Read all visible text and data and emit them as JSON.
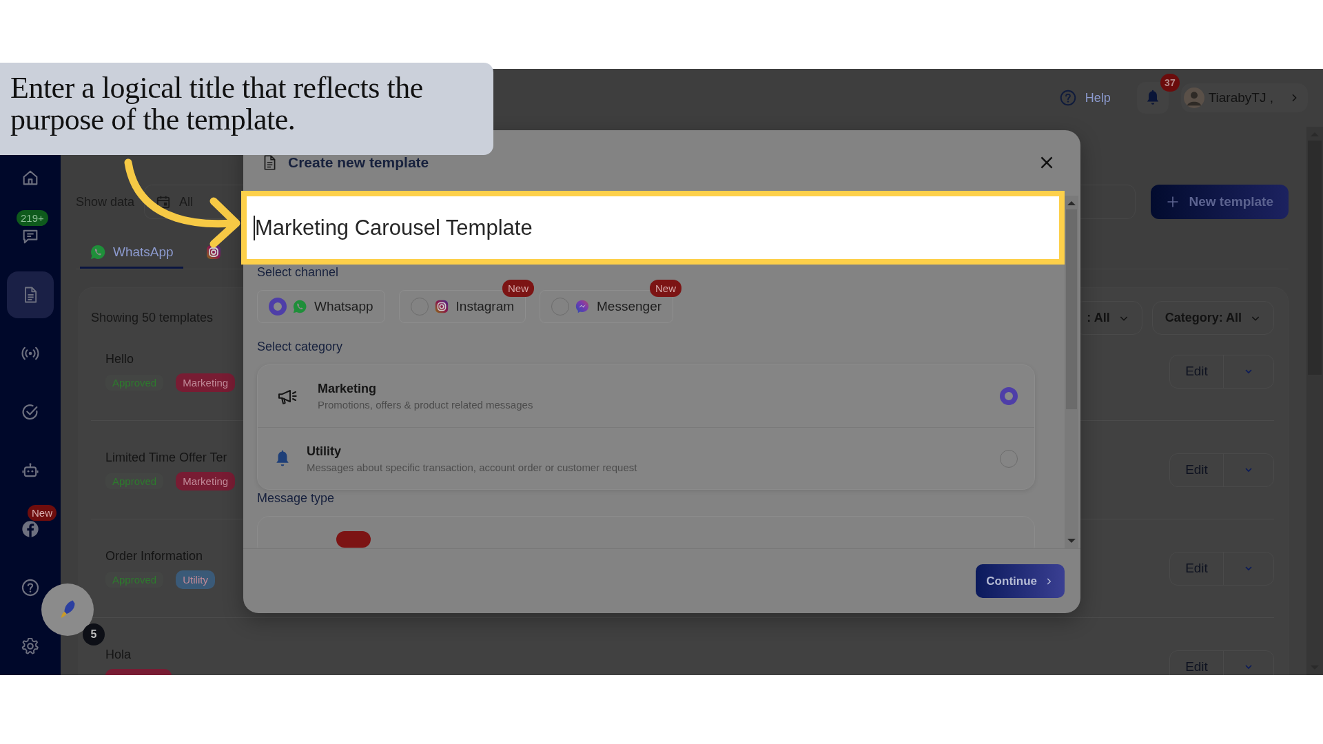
{
  "callout": {
    "text": "Enter a logical title that reflects the purpose of the template."
  },
  "header": {
    "help": "Help",
    "notifications": "37",
    "user": "TiarabyTJ ,"
  },
  "sidebar": {
    "items": [
      {
        "kind": "home",
        "selected": false
      },
      {
        "kind": "chat",
        "selected": false,
        "badge": "219+"
      },
      {
        "kind": "templates",
        "selected": true
      },
      {
        "kind": "broadcast",
        "selected": false
      },
      {
        "kind": "check",
        "selected": false
      },
      {
        "kind": "bot",
        "selected": false
      },
      {
        "kind": "facebook",
        "selected": false,
        "badge": "New"
      },
      {
        "kind": "help",
        "selected": false
      },
      {
        "kind": "settings",
        "selected": false
      }
    ]
  },
  "launcher": {
    "count": "5"
  },
  "page": {
    "date_label": "Show data",
    "date_value": "All",
    "new_button": "New template",
    "tabs": [
      {
        "kind": "whatsapp",
        "label": "WhatsApp",
        "selected": true
      },
      {
        "kind": "instagram",
        "selected": false
      }
    ],
    "count_text": "Showing 50 templates",
    "filters": [
      ": All",
      "Category: All"
    ],
    "rows": [
      {
        "name": "Hello",
        "status": "Approved",
        "category": {
          "label": "Marketing",
          "color": "#781c33"
        },
        "action": "Edit"
      },
      {
        "name": "Limited Time Offer Ter",
        "status": "Approved",
        "category": {
          "label": "Marketing",
          "color": "#781c33"
        },
        "action": "Edit"
      },
      {
        "name": "Order Information",
        "status": "Approved",
        "category": {
          "label": "Utility",
          "color": "#3a5a78"
        },
        "action": "Edit"
      },
      {
        "name": "Hola",
        "category": {
          "color": "#781c33"
        },
        "action": "Edit"
      }
    ]
  },
  "modal": {
    "title": "Create new template",
    "name_value": "Marketing Carousel Template",
    "channel_label": "Select channel",
    "channels": [
      {
        "kind": "whatsapp",
        "label": "Whatsapp",
        "selected": true
      },
      {
        "kind": "instagram",
        "label": "Instagram",
        "selected": false,
        "badge": "New"
      },
      {
        "kind": "messenger",
        "label": "Messenger",
        "selected": false,
        "badge": "New"
      }
    ],
    "category_label": "Select category",
    "categories": [
      {
        "kind": "megaphone",
        "title": "Marketing",
        "description": "Promotions, offers & product related messages",
        "selected": true
      },
      {
        "kind": "bell",
        "title": "Utility",
        "description": "Messages about specific transaction, account order or customer request",
        "selected": false
      }
    ],
    "message_type_label": "Message type",
    "continue_button": "Continue"
  }
}
